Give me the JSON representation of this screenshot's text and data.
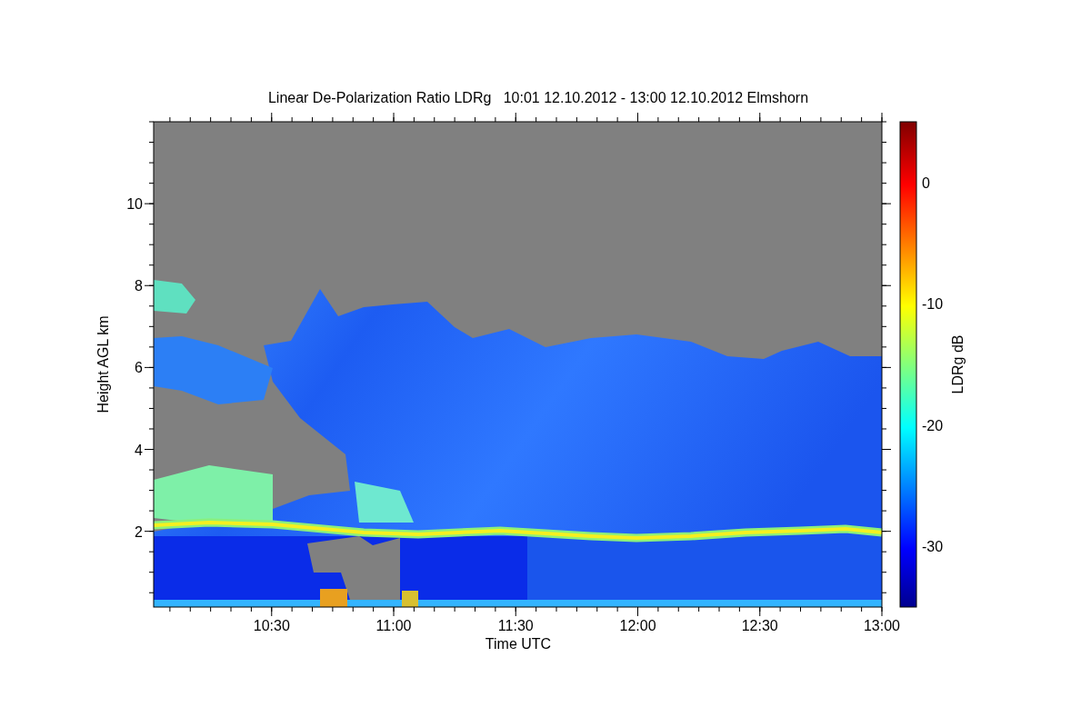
{
  "plot": {
    "title": "Linear De-Polarization Ratio LDRg   10:01 12.10.2012 - 13:00 12.10.2012 Elmshorn",
    "xlabel": "Time UTC",
    "ylabel": "Height AGL km",
    "xticks": [
      "10:30",
      "11:00",
      "11:30",
      "12:00",
      "12:30",
      "13:00"
    ],
    "yticks": [
      "10",
      "8",
      "6",
      "4",
      "2"
    ],
    "colorbar": {
      "label": "LDRg dB",
      "ticks": [
        "0",
        "-10",
        "-20",
        "-30"
      ]
    }
  }
}
